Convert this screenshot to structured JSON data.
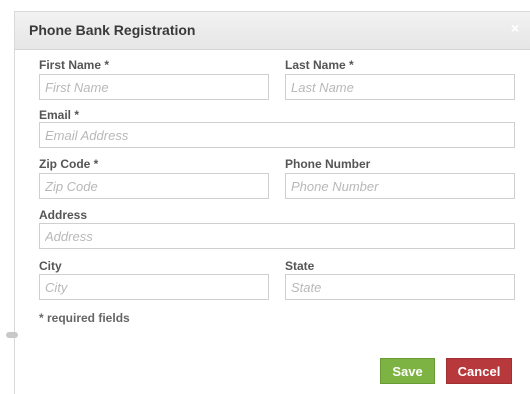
{
  "modal": {
    "title": "Phone Bank Registration",
    "close_icon": "close-icon",
    "close_glyph": "×"
  },
  "form": {
    "first_name": {
      "label": "First Name *",
      "placeholder": "First Name",
      "value": ""
    },
    "last_name": {
      "label": "Last Name *",
      "placeholder": "Last Name",
      "value": ""
    },
    "email": {
      "label": "Email *",
      "placeholder": "Email Address",
      "value": ""
    },
    "zip_code": {
      "label": "Zip Code *",
      "placeholder": "Zip Code",
      "value": ""
    },
    "phone_number": {
      "label": "Phone Number",
      "placeholder": "Phone Number",
      "value": ""
    },
    "address": {
      "label": "Address",
      "placeholder": "Address",
      "value": ""
    },
    "city": {
      "label": "City",
      "placeholder": "City",
      "value": ""
    },
    "state": {
      "label": "State",
      "placeholder": "State",
      "value": ""
    },
    "required_note": "* required fields"
  },
  "actions": {
    "save_label": "Save",
    "cancel_label": "Cancel",
    "save_color": "#7cb342",
    "cancel_color": "#b8393c"
  }
}
